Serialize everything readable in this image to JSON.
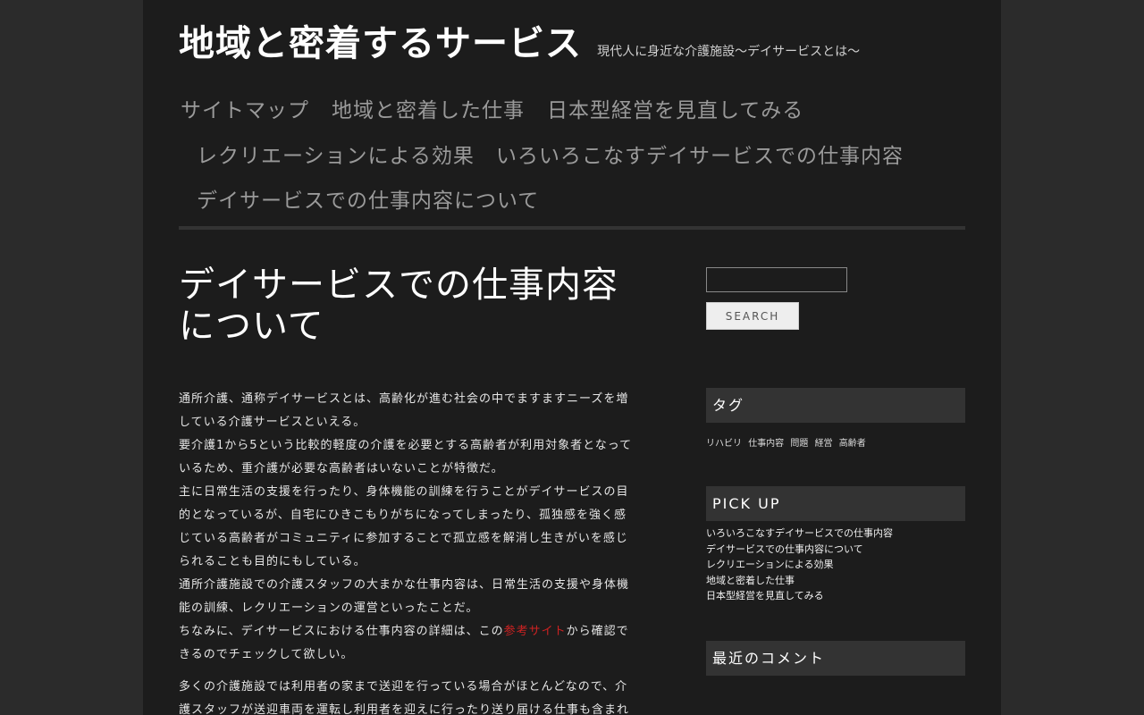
{
  "header": {
    "site_title": "地域と密着するサービス",
    "site_description": "現代人に身近な介護施設〜デイサービスとは〜"
  },
  "nav": {
    "items": [
      {
        "label": "サイトマップ"
      },
      {
        "label": "地域と密着した仕事"
      },
      {
        "label": "日本型経営を見直してみる"
      },
      {
        "label": "レクリエーションによる効果"
      },
      {
        "label": "いろいろこなすデイサービスでの仕事内容"
      },
      {
        "label": "デイサービスでの仕事内容について"
      }
    ]
  },
  "article": {
    "title_line1": "デイサービスでの仕事内容",
    "title_line2": "について",
    "p1": {
      "l1": "通所介護、通称デイサービスとは、高齢化が進む社会の中でますますニーズを増",
      "l2": "している介護サービスといえる。",
      "l3": "要介護1から5という比較的軽度の介護を必要とする高齢者が利用対象者となって",
      "l4": "いるため、重介護が必要な高齢者はいないことが特徴だ。",
      "l5": "主に日常生活の支援を行ったり、身体機能の訓練を行うことがデイサービスの目",
      "l6": "的となっているが、自宅にひきこもりがちになってしまったり、孤独感を強く感",
      "l7": "じている高齢者がコミュニティに参加することで孤立感を解消し生きがいを感じ",
      "l8": "られることも目的にもしている。",
      "l9": "通所介護施設での介護スタッフの大まかな仕事内容は、日常生活の支援や身体機",
      "l10": "能の訓練、レクリエーションの運営といったことだ。",
      "l11_before": "ちなみに、デイサービスにおける仕事内容の詳細は、この",
      "l11_link": "参考サイト",
      "l11_after": "から確認で",
      "l12": "きるのでチェックして欲しい。"
    },
    "p2": {
      "l1": "多くの介護施設では利用者の家まで送迎を行っている場合がほとんどなので、介",
      "l2": "護スタッフが送迎車両を運転し利用者を迎えに行ったり送り届ける仕事も含まれ"
    }
  },
  "sidebar": {
    "search_value": "",
    "search_button": "SEARCH",
    "tags_title": "タグ",
    "tags": [
      "リハビリ",
      "仕事内容",
      "問題",
      "経営",
      "高齢者"
    ],
    "pickup_title": "PICK UP",
    "pickup_items": [
      "いろいろこなすデイサービスでの仕事内容",
      "デイサービスでの仕事内容について",
      "レクリエーションによる効果",
      "地域と密着した仕事",
      "日本型経営を見直してみる"
    ],
    "comments_title": "最近のコメント"
  },
  "colors": {
    "page_bg": "#2b2b2b",
    "content_bg": "#1c1c1c",
    "widget_title_bg": "#333333",
    "nav_text": "#9a9a9a",
    "link_accent": "#cc2222"
  }
}
